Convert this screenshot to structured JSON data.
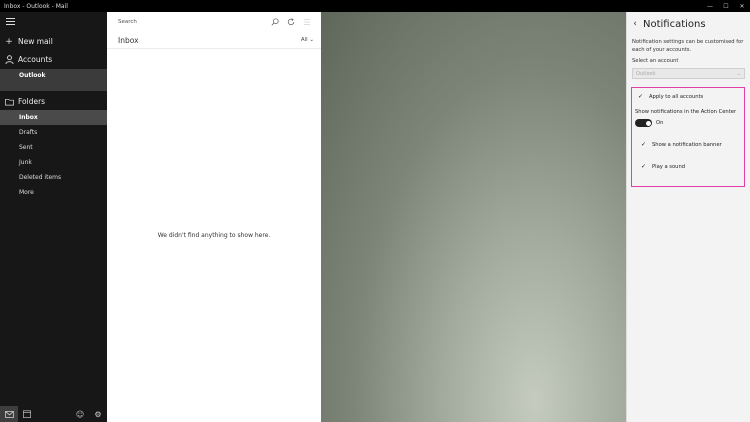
{
  "window": {
    "title": "Inbox - Outlook - Mail",
    "controls": {
      "minimize": "—",
      "maximize": "☐",
      "close": "✕"
    }
  },
  "nav": {
    "new_mail": "New mail",
    "accounts": "Accounts",
    "account_name": "Outlook",
    "folders": "Folders",
    "folder_items": [
      {
        "label": "Inbox",
        "selected": true
      },
      {
        "label": "Drafts",
        "selected": false
      },
      {
        "label": "Sent",
        "selected": false
      },
      {
        "label": "Junk",
        "selected": false
      },
      {
        "label": "Deleted items",
        "selected": false
      },
      {
        "label": "More",
        "selected": false
      }
    ]
  },
  "list": {
    "search_placeholder": "Search",
    "folder_title": "Inbox",
    "filter": "All",
    "empty_message": "We didn't find anything to show here."
  },
  "settings": {
    "title": "Notifications",
    "description": "Notification settings can be customised for each of your accounts.",
    "select_label": "Select an account",
    "selected_account": "Outlook",
    "apply_all": {
      "label": "Apply to all accounts",
      "checked": true
    },
    "action_center_label": "Show notifications in the Action Center",
    "toggle_state": "On",
    "banner": {
      "label": "Show a notification banner",
      "checked": true
    },
    "sound": {
      "label": "Play a sound",
      "checked": true
    }
  },
  "colors": {
    "highlight_border": "#e040a8",
    "nav_background": "#171717",
    "settings_background": "#f3f3f3"
  }
}
